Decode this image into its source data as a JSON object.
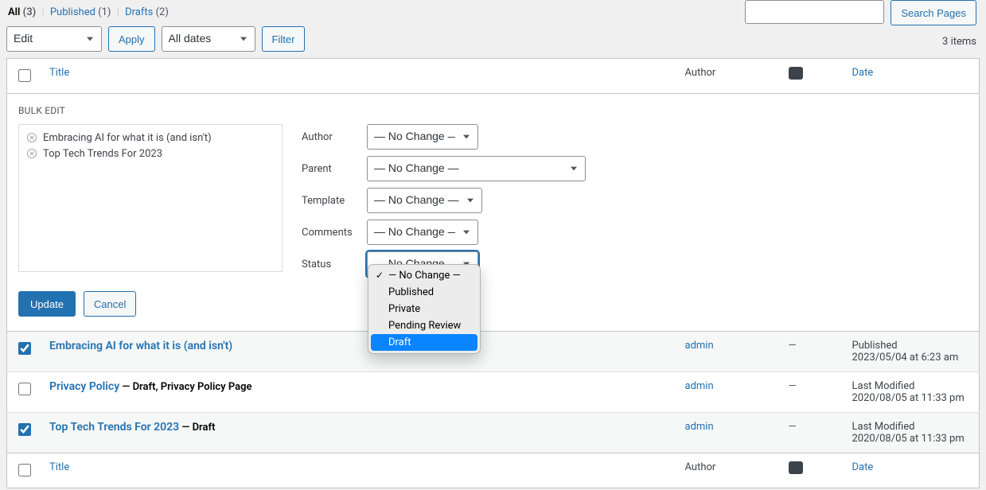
{
  "filters": {
    "all": {
      "label": "All",
      "count": "(3)"
    },
    "published": {
      "label": "Published",
      "count": "(1)"
    },
    "drafts": {
      "label": "Drafts",
      "count": "(2)"
    }
  },
  "search": {
    "button": "Search Pages",
    "value": ""
  },
  "bulk": {
    "action_selected": "Edit",
    "apply": "Apply",
    "dates_selected": "All dates",
    "filter": "Filter",
    "items": "3 items"
  },
  "columns": {
    "title": "Title",
    "author": "Author",
    "date": "Date"
  },
  "bulkedit": {
    "legend": "BULK EDIT",
    "items": [
      "Embracing AI for what it is (and isn't)",
      "Top Tech Trends For 2023"
    ],
    "labels": {
      "author": "Author",
      "parent": "Parent",
      "template": "Template",
      "comments": "Comments",
      "status": "Status"
    },
    "nochange": "— No Change —",
    "update": "Update",
    "cancel": "Cancel",
    "status_options": [
      "— No Change —",
      "Published",
      "Private",
      "Pending Review",
      "Draft"
    ]
  },
  "rows": [
    {
      "title": "Embracing AI for what it is (and isn't)",
      "state": "",
      "author": "admin",
      "comments": "—",
      "date_type": "Published",
      "date_ts": "2023/05/04 at 6:23 am",
      "checked": true
    },
    {
      "title": "Privacy Policy",
      "state": " — Draft, Privacy Policy Page",
      "author": "admin",
      "comments": "—",
      "date_type": "Last Modified",
      "date_ts": "2020/08/05 at 11:33 pm",
      "checked": false
    },
    {
      "title": "Top Tech Trends For 2023",
      "state": " — Draft",
      "author": "admin",
      "comments": "—",
      "date_type": "Last Modified",
      "date_ts": "2020/08/05 at 11:33 pm",
      "checked": true
    }
  ]
}
